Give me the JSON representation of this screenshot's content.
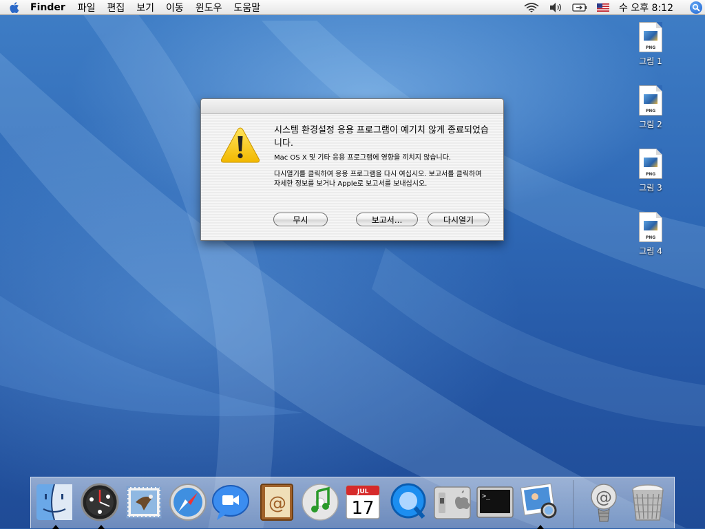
{
  "menubar": {
    "app_name": "Finder",
    "menus": [
      "파일",
      "편집",
      "보기",
      "이동",
      "윈도우",
      "도움말"
    ],
    "clock": "수 오후 8:12",
    "status_icons": [
      "wifi-icon",
      "volume-icon",
      "battery-icon",
      "us-flag-icon",
      "spotlight-icon"
    ]
  },
  "desktop_icons": [
    {
      "label": "그림 1",
      "type": "PNG"
    },
    {
      "label": "그림 2",
      "type": "PNG"
    },
    {
      "label": "그림 3",
      "type": "PNG"
    },
    {
      "label": "그림 4",
      "type": "PNG"
    }
  ],
  "alert": {
    "title": "시스템 환경설정 응용 프로그램이 예기치 않게 종료되었습니다.",
    "line1": "Mac OS X 및 기타 응용 프로그램에 영향을 끼치지 않습니다.",
    "line2": "다시열기를 클릭하여 응용 프로그램을 다시 여십시오. 보고서를 클릭하여 자세한 정보를 보거나 Apple로 보고서를 보내십시오.",
    "buttons": {
      "ignore": "무시",
      "report": "보고서...",
      "reopen": "다시열기"
    }
  },
  "dock": {
    "items": [
      "finder-icon",
      "dashboard-icon",
      "mail-icon",
      "safari-icon",
      "ichat-icon",
      "address-book-icon",
      "itunes-icon",
      "ical-icon",
      "quicktime-icon",
      "system-preferences-icon",
      "terminal-icon",
      "preview-icon"
    ],
    "right_items": [
      "downloads-stack-icon",
      "trash-icon"
    ],
    "ical_month": "JUL",
    "ical_day": "17"
  },
  "colors": {
    "desktop": "#2f69b6",
    "warning": "#f5c400",
    "accent": "#1a5fd0"
  }
}
